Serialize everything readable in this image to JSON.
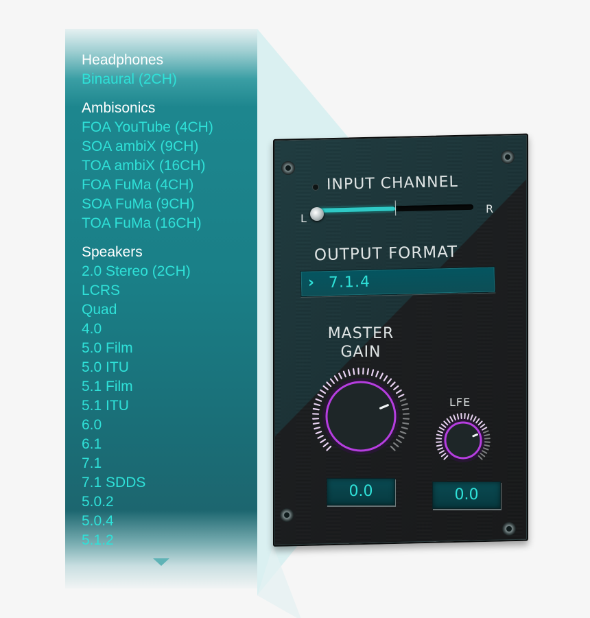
{
  "format_list": {
    "groups": [
      {
        "header": "Headphones",
        "items": [
          "Binaural (2CH)"
        ]
      },
      {
        "header": "Ambisonics",
        "items": [
          "FOA YouTube (4CH)",
          "SOA ambiX (9CH)",
          "TOA ambiX (16CH)",
          "FOA FuMa (4CH)",
          "SOA FuMa (9CH)",
          "TOA FuMa (16CH)"
        ]
      },
      {
        "header": "Speakers",
        "items": [
          "2.0 Stereo (2CH)",
          "LCRS",
          "Quad",
          "4.0",
          "5.0 Film",
          "5.0 ITU",
          "5.1 Film",
          "5.1 ITU",
          "6.0",
          "6.1",
          "7.1",
          "7.1 SDDS",
          "5.0.2",
          "5.0.4",
          "5.1.2"
        ]
      }
    ],
    "scroll_icon": "triangle-down"
  },
  "panel": {
    "input_channel": {
      "label": "INPUT CHANNEL",
      "left_label": "L",
      "right_label": "R",
      "position_fraction": 0.0,
      "fill_fraction": 0.5
    },
    "output_format": {
      "label": "OUTPUT FORMAT",
      "chevron": "›",
      "value": "7.1.4"
    },
    "master_gain": {
      "label_line1": "MASTER",
      "label_line2": "GAIN",
      "value": "0.0",
      "knob_fraction": 0.75
    },
    "lfe": {
      "label": "LFE",
      "value": "0.0",
      "knob_fraction": 0.75
    }
  },
  "colors": {
    "accent_teal": "#2fe1d8",
    "knob_ring": "#b63ee0",
    "list_bg": "#1a7f87",
    "group_header": "#ffffff"
  }
}
